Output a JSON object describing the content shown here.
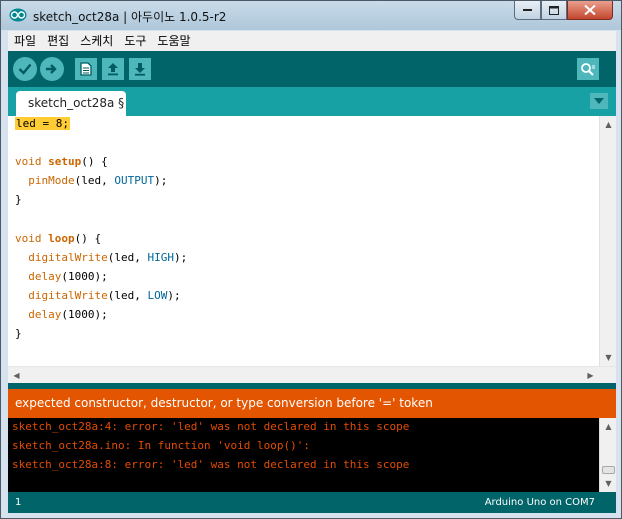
{
  "window": {
    "title": "sketch_oct28a | 아두이노 1.0.5-r2"
  },
  "menu": [
    "파일",
    "편집",
    "스케치",
    "도구",
    "도움말"
  ],
  "toolbar": {
    "buttons": [
      "verify-icon",
      "upload-icon",
      "new-icon",
      "open-icon",
      "save-icon"
    ],
    "serial_monitor": "serial-monitor-icon"
  },
  "tabs": [
    {
      "label": "sketch_oct28a §"
    }
  ],
  "editor": {
    "lines": [
      "led = 8;",
      "",
      "void setup() {",
      "  pinMode(led, OUTPUT);",
      "}",
      "",
      "void loop() {",
      "  digitalWrite(led, HIGH);",
      "  delay(1000);",
      "  digitalWrite(led, LOW);",
      "  delay(1000);",
      "}"
    ]
  },
  "status": {
    "message": "expected constructor, destructor, or type conversion before '=' token"
  },
  "console": {
    "lines": [
      "sketch_oct28a:4: error: 'led' was not declared in this scope",
      "sketch_oct28a.ino: In function 'void loop()':",
      "sketch_oct28a:8: error: 'led' was not declared in this scope"
    ]
  },
  "footer": {
    "line_number": "1",
    "board": "Arduino Uno on COM7"
  },
  "colors": {
    "toolbar": "#006468",
    "tabbar": "#17a1a5",
    "button": "#4db7bb",
    "status": "#e35500",
    "console_text": "#e34c00",
    "keyword": "#cc6600",
    "constant": "#006699",
    "highlight": "#ffcc33"
  }
}
